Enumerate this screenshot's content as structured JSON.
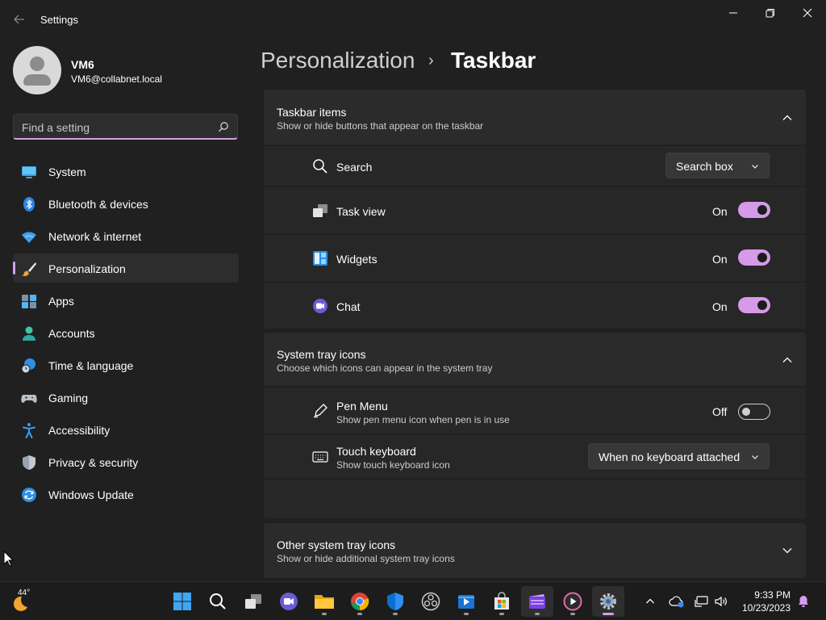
{
  "window": {
    "title": "Settings"
  },
  "user": {
    "name": "VM6",
    "email": "VM6@collabnet.local"
  },
  "search": {
    "placeholder": "Find a setting"
  },
  "sidebar": {
    "items": [
      {
        "label": "System",
        "icon": "monitor-icon"
      },
      {
        "label": "Bluetooth & devices",
        "icon": "bluetooth-icon"
      },
      {
        "label": "Network & internet",
        "icon": "wifi-icon"
      },
      {
        "label": "Personalization",
        "icon": "brush-icon",
        "active": true
      },
      {
        "label": "Apps",
        "icon": "apps-icon"
      },
      {
        "label": "Accounts",
        "icon": "person-icon"
      },
      {
        "label": "Time & language",
        "icon": "globe-clock-icon"
      },
      {
        "label": "Gaming",
        "icon": "gamepad-icon"
      },
      {
        "label": "Accessibility",
        "icon": "accessibility-icon"
      },
      {
        "label": "Privacy & security",
        "icon": "shield-icon"
      },
      {
        "label": "Windows Update",
        "icon": "update-icon"
      }
    ]
  },
  "breadcrumb": {
    "parent": "Personalization",
    "separator": "›",
    "current": "Taskbar"
  },
  "taskbar_items": {
    "title": "Taskbar items",
    "subtitle": "Show or hide buttons that appear on the taskbar",
    "rows": {
      "search": {
        "label": "Search",
        "value": "Search box"
      },
      "task_view": {
        "label": "Task view",
        "state": "On"
      },
      "widgets": {
        "label": "Widgets",
        "state": "On"
      },
      "chat": {
        "label": "Chat",
        "state": "On"
      }
    }
  },
  "system_tray": {
    "title": "System tray icons",
    "subtitle": "Choose which icons can appear in the system tray",
    "rows": {
      "pen": {
        "label": "Pen Menu",
        "sub": "Show pen menu icon when pen is in use",
        "state": "Off"
      },
      "keyboard": {
        "label": "Touch keyboard",
        "sub": "Show touch keyboard icon",
        "value": "When no keyboard attached"
      }
    }
  },
  "other_tray": {
    "title": "Other system tray icons",
    "subtitle": "Show or hide additional system tray icons"
  },
  "taskbar": {
    "weather": "44°",
    "time": "9:33 PM",
    "date": "10/23/2023"
  },
  "colors": {
    "accent": "#d69ef2",
    "toggle_on": "#d59ae8",
    "background": "#202020",
    "card": "#2b2b2b"
  }
}
